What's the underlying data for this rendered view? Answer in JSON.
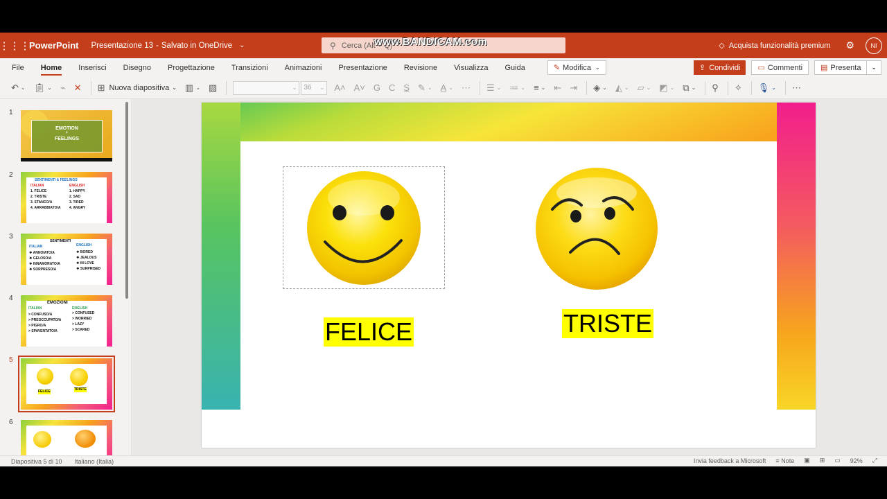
{
  "titlebar": {
    "app_name": "PowerPoint",
    "doc_name": "Presentazione 13",
    "separator": "-",
    "saved_status": "Salvato in OneDrive",
    "search_placeholder": "Cerca (Alt + Q)",
    "watermark": "www.BANDICAM.com",
    "premium": "Acquista funzionalità premium",
    "avatar_initials": "NI"
  },
  "ribbon": {
    "tabs": [
      "File",
      "Home",
      "Inserisci",
      "Disegno",
      "Progettazione",
      "Transizioni",
      "Animazioni",
      "Presentazione",
      "Revisione",
      "Visualizza",
      "Guida"
    ],
    "active_tab": "Home",
    "modifica_label": "Modifica",
    "share_label": "Condividi",
    "comments_label": "Commenti",
    "present_label": "Presenta"
  },
  "toolbar": {
    "new_slide_label": "Nuova diapositiva",
    "font_name": "",
    "font_size": "36"
  },
  "thumbnails": {
    "numbers": [
      "1",
      "2",
      "3",
      "4",
      "5",
      "6"
    ],
    "active": "5",
    "slide1": {
      "line1": "EMOTION",
      "line2": "+",
      "line3": "FEELINGS"
    },
    "slide2": {
      "title": "SENTIMENTI & FEELINGS",
      "col1_head": "ITALIAN",
      "col2_head": "ENGLISH",
      "col1": [
        "1. FELICE",
        "2. TRISTE",
        "3. STANCO/A",
        "4. ARRABBIATO/A"
      ],
      "col2": [
        "1. HAPPY",
        "2. SAD",
        "3. TIRED",
        "4. ANGRY"
      ]
    },
    "slide3": {
      "title": "SENTIMENTI",
      "col1_head": "ITALIAN",
      "col2_head": "ENGLISH",
      "col1": [
        "❖ ANNOIATO/A",
        "❖ GELOSO/A",
        "❖ INNAMORATO/A",
        "❖ SORPRESO/A"
      ],
      "col2": [
        "❖ BORED",
        "❖ JEALOUS",
        "❖ IN LOVE",
        "❖ SURPRISED"
      ]
    },
    "slide4": {
      "title": "EMOZIONI",
      "col1_head": "ITALIAN",
      "col2_head": "ENGLISH",
      "col1": [
        "> CONFUSO/A",
        "> PREOCCUPATO/A",
        "> PIGRO/A",
        "> SPAVENTATO/A"
      ],
      "col2": [
        "> CONFUSED",
        "> WORRIED",
        "> LAZY",
        "> SCARED"
      ]
    },
    "slide5": {
      "label1": "FELICE",
      "label2": "TRISTE"
    }
  },
  "slide": {
    "label_happy": "FELICE",
    "label_sad": "TRISTE"
  },
  "statusbar": {
    "slide_count": "Diapositiva 5 di 10",
    "language": "Italiano (Italia)",
    "feedback": "Invia feedback a Microsoft",
    "notes": "Note",
    "zoom": "92%"
  },
  "colors": {
    "accent": "#c43e1c",
    "highlight": "#ffff00"
  }
}
